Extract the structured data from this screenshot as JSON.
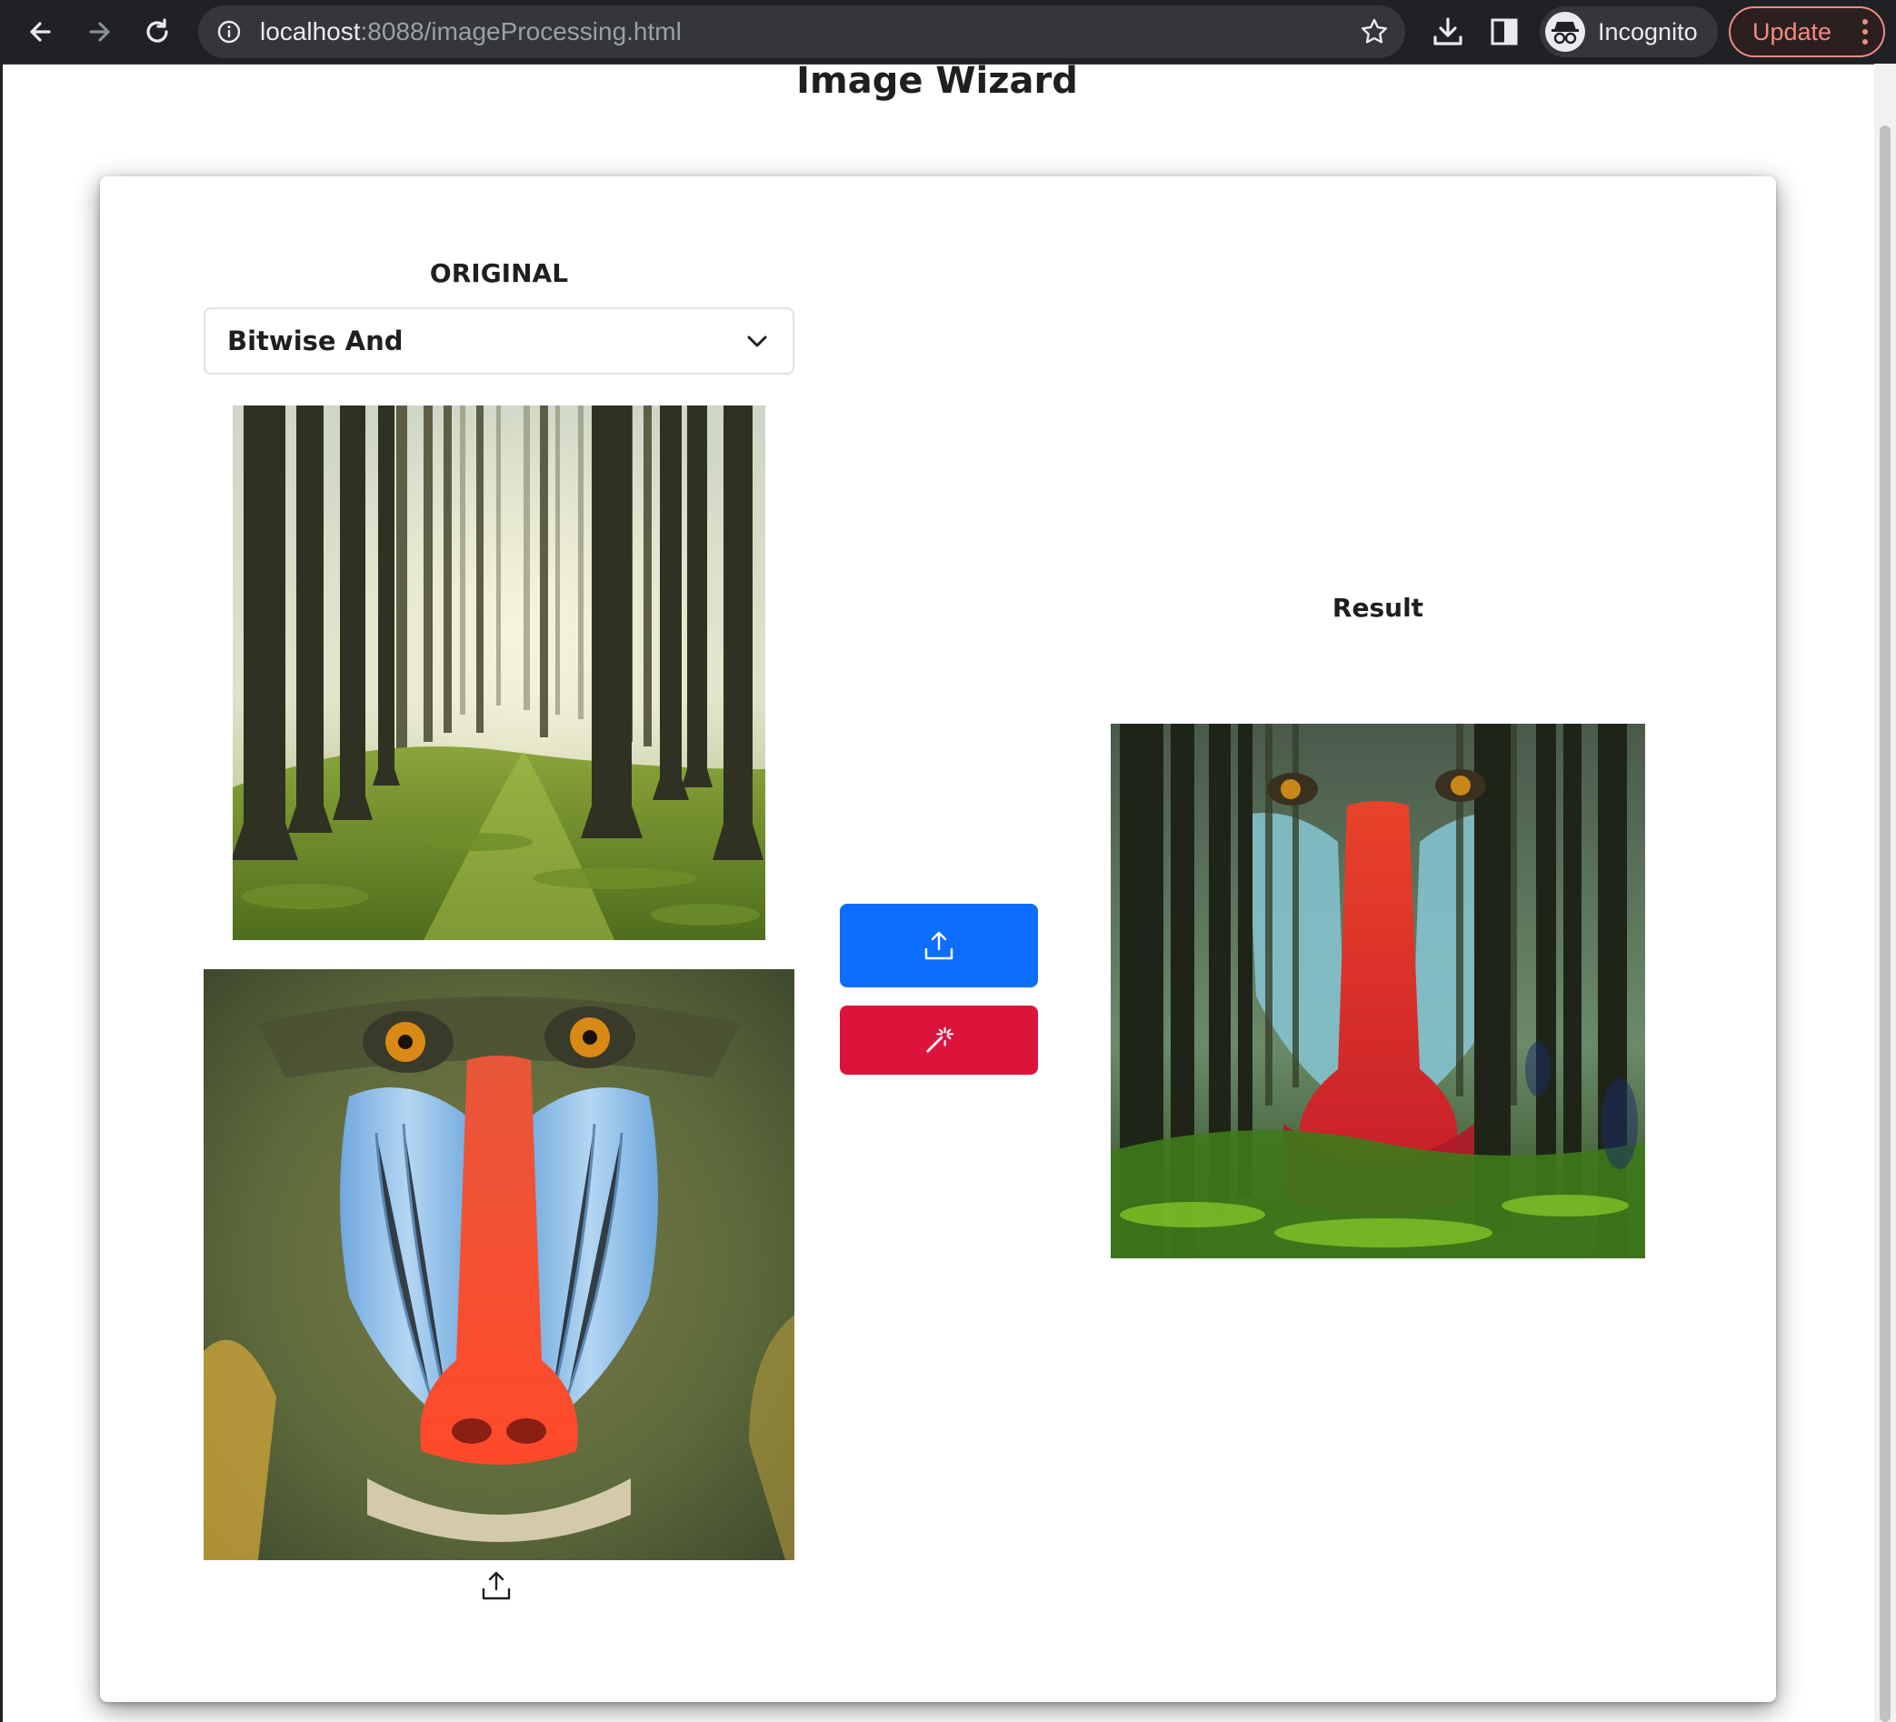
{
  "browser": {
    "url_host": "localhost",
    "url_rest": ":8088/imageProcessing.html",
    "profile_label": "Incognito",
    "update_label": "Update",
    "icons": [
      "back-arrow-icon",
      "forward-arrow-icon",
      "reload-icon",
      "info-icon",
      "star-icon",
      "download-icon",
      "side-panel-icon",
      "incognito-icon",
      "more-vert-icon"
    ]
  },
  "page": {
    "title": "Image Wizard"
  },
  "original": {
    "heading": "ORIGINAL",
    "operation_selected": "Bitwise And",
    "images": [
      "forest-image",
      "mandrill-image"
    ]
  },
  "actions": {
    "upload_icon": "upload-icon",
    "apply_icon": "magic-wand-icon",
    "colors": {
      "upload": "#0d6efd",
      "apply": "#dc143c"
    }
  },
  "result": {
    "heading": "Result"
  }
}
